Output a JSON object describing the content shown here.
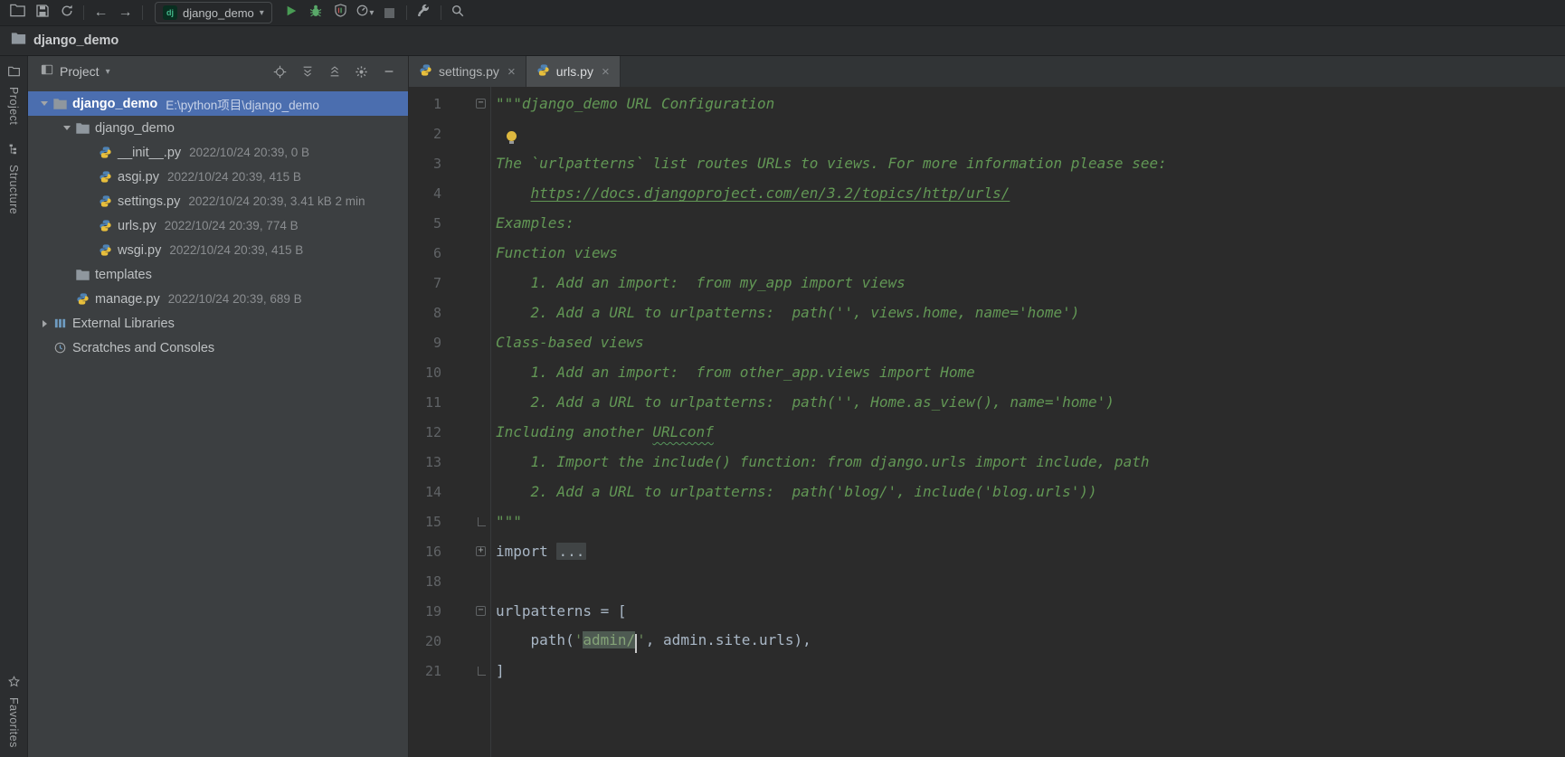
{
  "colors": {
    "selection_blue": "#4b6eaf",
    "editor_bg": "#2b2b2b",
    "panel_bg": "#3c3f41",
    "docstring_green": "#629755",
    "string_green": "#6a8759",
    "run_green": "#499c54"
  },
  "icons": {
    "close": "×",
    "dropdown_arrow": "▾",
    "back_arrow": "←",
    "forward_arrow": "→",
    "fold_open_marker": "−",
    "fold_closed_marker": "+"
  },
  "toolbar": {
    "run_config": {
      "icon_label": "dj",
      "label": "django_demo"
    }
  },
  "navbar": {
    "project": "django_demo"
  },
  "stripes": {
    "top": [
      "Project",
      "Structure"
    ],
    "bottom": [
      "Favorites"
    ]
  },
  "project": {
    "header": {
      "title": "Project"
    },
    "tree": [
      {
        "label": "django_demo",
        "detail": "E:\\python项目\\django_demo",
        "type": "folder",
        "level": 0,
        "chevron": "expanded",
        "selected": true,
        "bold": true
      },
      {
        "label": "django_demo",
        "type": "folder",
        "level": 1,
        "chevron": "expanded"
      },
      {
        "label": "__init__.py",
        "detail": "2022/10/24 20:39, 0 B",
        "type": "python",
        "level": 2,
        "chevron": "none"
      },
      {
        "label": "asgi.py",
        "detail": "2022/10/24 20:39, 415 B",
        "type": "python",
        "level": 2,
        "chevron": "none"
      },
      {
        "label": "settings.py",
        "detail": "2022/10/24 20:39, 3.41 kB 2 min",
        "type": "python",
        "level": 2,
        "chevron": "none"
      },
      {
        "label": "urls.py",
        "detail": "2022/10/24 20:39, 774 B",
        "type": "python",
        "level": 2,
        "chevron": "none"
      },
      {
        "label": "wsgi.py",
        "detail": "2022/10/24 20:39, 415 B",
        "type": "python",
        "level": 2,
        "chevron": "none"
      },
      {
        "label": "templates",
        "type": "folder",
        "level": 1,
        "chevron": "none"
      },
      {
        "label": "manage.py",
        "detail": "2022/10/24 20:39, 689 B",
        "type": "python",
        "level": 1,
        "chevron": "none"
      },
      {
        "label": "External Libraries",
        "type": "libraries",
        "level": 0,
        "chevron": "collapsed"
      },
      {
        "label": "Scratches and Consoles",
        "type": "scratches",
        "level": 0,
        "chevron": "none"
      }
    ]
  },
  "tabs": [
    {
      "label": "settings.py",
      "active": false
    },
    {
      "label": "urls.py",
      "active": true
    }
  ],
  "editor": {
    "lines": [
      {
        "n": "1",
        "fold": "open",
        "seg": [
          {
            "t": "\"\"\"django_demo URL Configuration",
            "s": "doc"
          }
        ]
      },
      {
        "n": "2",
        "bulb": true,
        "seg": []
      },
      {
        "n": "3",
        "seg": [
          {
            "t": "The `urlpatterns` list routes URLs to views. For more information please see:",
            "s": "doc"
          }
        ]
      },
      {
        "n": "4",
        "seg": [
          {
            "t": "    ",
            "s": "doc"
          },
          {
            "t": "https://docs.djangoproject.com/en/3.2/topics/http/urls/",
            "s": "doclink"
          }
        ]
      },
      {
        "n": "5",
        "seg": [
          {
            "t": "Examples:",
            "s": "doc"
          }
        ]
      },
      {
        "n": "6",
        "seg": [
          {
            "t": "Function views",
            "s": "doc"
          }
        ]
      },
      {
        "n": "7",
        "seg": [
          {
            "t": "    1. Add an import:  from my_app import views",
            "s": "doc"
          }
        ]
      },
      {
        "n": "8",
        "seg": [
          {
            "t": "    2. Add a URL to urlpatterns:  path('', views.home, name='home')",
            "s": "doc"
          }
        ]
      },
      {
        "n": "9",
        "seg": [
          {
            "t": "Class-based views",
            "s": "doc"
          }
        ]
      },
      {
        "n": "10",
        "seg": [
          {
            "t": "    1. Add an import:  from other_app.views import Home",
            "s": "doc"
          }
        ]
      },
      {
        "n": "11",
        "seg": [
          {
            "t": "    2. Add a URL to urlpatterns:  path('', Home.as_view(), name='home')",
            "s": "doc"
          }
        ]
      },
      {
        "n": "12",
        "seg": [
          {
            "t": "Including another ",
            "s": "doc"
          },
          {
            "t": "URLconf",
            "s": "doctypo"
          }
        ]
      },
      {
        "n": "13",
        "seg": [
          {
            "t": "    1. Import the include() function: from django.urls import include, path",
            "s": "doc"
          }
        ]
      },
      {
        "n": "14",
        "seg": [
          {
            "t": "    2. Add a URL to urlpatterns:  path('blog/', include('blog.urls'))",
            "s": "doc"
          }
        ]
      },
      {
        "n": "15",
        "fold": "end",
        "seg": [
          {
            "t": "\"\"\"",
            "s": "doc"
          }
        ]
      },
      {
        "n": "16",
        "fold": "closed",
        "seg": [
          {
            "t": "import ",
            "s": "plain"
          },
          {
            "t": "...",
            "s": "folded"
          }
        ]
      },
      {
        "n": "18",
        "seg": []
      },
      {
        "n": "19",
        "fold": "open",
        "seg": [
          {
            "t": "urlpatterns = [",
            "s": "plain"
          }
        ]
      },
      {
        "n": "20",
        "seg": [
          {
            "t": "    path(",
            "s": "plain"
          },
          {
            "t": "'",
            "s": "str"
          },
          {
            "t": "admin/",
            "s": "strhl"
          },
          {
            "t": "",
            "s": "caret"
          },
          {
            "t": "'",
            "s": "str"
          },
          {
            "t": ", admin.site.urls),",
            "s": "plain"
          }
        ]
      },
      {
        "n": "21",
        "fold": "end",
        "seg": [
          {
            "t": "]",
            "s": "plain"
          }
        ]
      }
    ]
  }
}
